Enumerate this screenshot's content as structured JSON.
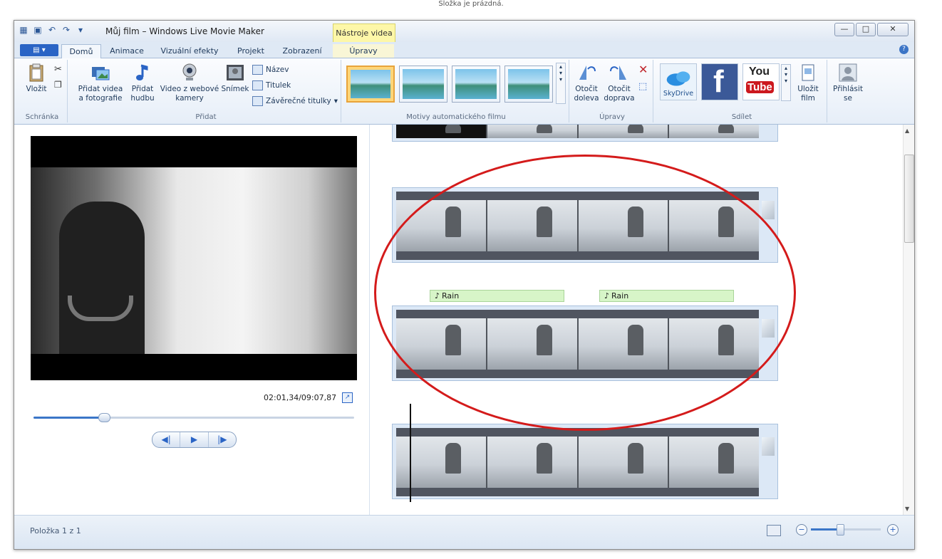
{
  "caption": "Složka je prázdná.",
  "window": {
    "title": "Můj film – Windows Live Movie Maker",
    "context_tab_header": "Nástroje videa",
    "controls": {
      "minimize": "—",
      "maximize": "□",
      "close": "✕"
    }
  },
  "tabs": {
    "file": "▤ ▾",
    "items": [
      "Domů",
      "Animace",
      "Vizuální efekty",
      "Projekt",
      "Zobrazení"
    ],
    "context_tab": "Úpravy",
    "help": "?"
  },
  "ribbon": {
    "clipboard": {
      "paste": "Vložit",
      "label": "Schránka"
    },
    "add": {
      "add_video": "Přidat videa a fotografie",
      "add_music": "Přidat hudbu",
      "webcam": "Video z webové kamery",
      "snapshot": "Snímek",
      "title": "Název",
      "caption": "Titulek",
      "credits": "Závěrečné titulky",
      "label": "Přidat"
    },
    "themes": {
      "label": "Motivy automatického filmu"
    },
    "edit": {
      "rotate_left": "Otočit doleva",
      "rotate_right": "Otočit doprava",
      "label": "Úpravy"
    },
    "share": {
      "skydrive": "SkyDrive",
      "youtube_1": "You",
      "youtube_2": "Tube",
      "save": "Uložit film",
      "label": "Sdílet"
    },
    "signin": "Přihlásit se"
  },
  "player": {
    "time": "02:01,34/09:07,87",
    "progress": 0.22,
    "buttons": {
      "prev": "◀|",
      "play": "▶",
      "next": "|▶"
    }
  },
  "storyboard": {
    "music_clips": [
      {
        "label": "Rain"
      },
      {
        "label": "Rain"
      }
    ]
  },
  "status": {
    "text": "Položka 1 z 1",
    "zoom": 0.42,
    "zoom_minus": "−",
    "zoom_plus": "+"
  },
  "colors": {
    "accent": "#2a64c5",
    "annotation": "#d41b1b",
    "music": "#d7f5c8"
  }
}
